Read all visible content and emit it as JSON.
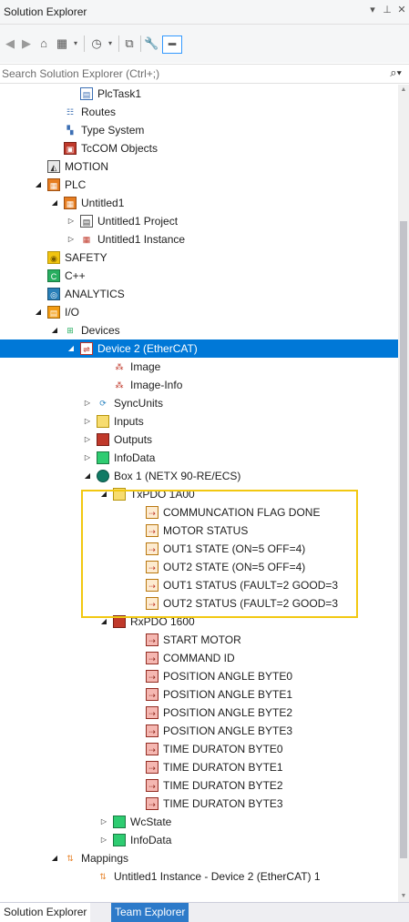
{
  "window": {
    "title": "Solution Explorer",
    "pin_glyph": "▾",
    "pin2_glyph": "⊥",
    "close_glyph": "✕"
  },
  "search": {
    "placeholder": "Search Solution Explorer (Ctrl+;)"
  },
  "tree": [
    {
      "label": "PlcTask1",
      "icon": "task-icon",
      "level": 5,
      "expander": ""
    },
    {
      "label": "Routes",
      "icon": "routes-icon",
      "level": 4,
      "expander": ""
    },
    {
      "label": "Type System",
      "icon": "type-system-icon",
      "level": 4,
      "expander": ""
    },
    {
      "label": "TcCOM Objects",
      "icon": "tccom-icon",
      "level": 4,
      "expander": ""
    },
    {
      "label": "MOTION",
      "icon": "motion-icon",
      "level": 3,
      "expander": ""
    },
    {
      "label": "PLC",
      "icon": "plc-icon",
      "level": 3,
      "expander": "open"
    },
    {
      "label": "Untitled1",
      "icon": "plc-project-icon",
      "level": 4,
      "expander": "open"
    },
    {
      "label": "Untitled1 Project",
      "icon": "project-icon",
      "level": 5,
      "expander": "closed"
    },
    {
      "label": "Untitled1 Instance",
      "icon": "instance-icon",
      "level": 5,
      "expander": "closed"
    },
    {
      "label": "SAFETY",
      "icon": "safety-icon",
      "level": 3,
      "expander": ""
    },
    {
      "label": "C++",
      "icon": "cpp-icon",
      "level": 3,
      "expander": ""
    },
    {
      "label": "ANALYTICS",
      "icon": "analytics-icon",
      "level": 3,
      "expander": ""
    },
    {
      "label": "I/O",
      "icon": "io-icon",
      "level": 3,
      "expander": "open"
    },
    {
      "label": "Devices",
      "icon": "devices-icon",
      "level": 4,
      "expander": "open"
    },
    {
      "label": "Device 2 (EtherCAT)",
      "icon": "ethercat-device-icon",
      "level": 5,
      "expander": "open",
      "selected": true
    },
    {
      "label": "Image",
      "icon": "image-icon",
      "level": 7,
      "expander": ""
    },
    {
      "label": "Image-Info",
      "icon": "image-info-icon",
      "level": 7,
      "expander": ""
    },
    {
      "label": "SyncUnits",
      "icon": "sync-icon",
      "level": 6,
      "expander": "closed"
    },
    {
      "label": "Inputs",
      "icon": "inputs-icon",
      "level": 6,
      "expander": "closed"
    },
    {
      "label": "Outputs",
      "icon": "outputs-icon",
      "level": 6,
      "expander": "closed"
    },
    {
      "label": "InfoData",
      "icon": "infodata-icon",
      "level": 6,
      "expander": "closed"
    },
    {
      "label": "Box 1 (NETX 90-RE/ECS)",
      "icon": "box-icon",
      "level": 6,
      "expander": "open"
    },
    {
      "label": "TxPDO 1A00",
      "icon": "txpdo-icon",
      "level": 7,
      "expander": "open"
    },
    {
      "label": "COMMUNCATION FLAG DONE",
      "icon": "input-var-icon",
      "level": 9,
      "expander": ""
    },
    {
      "label": "MOTOR STATUS",
      "icon": "input-var-icon",
      "level": 9,
      "expander": ""
    },
    {
      "label": "OUT1 STATE (ON=5 OFF=4)",
      "icon": "input-var-linked-icon",
      "level": 9,
      "expander": ""
    },
    {
      "label": "OUT2 STATE (ON=5 OFF=4)",
      "icon": "input-var-linked-icon",
      "level": 9,
      "expander": ""
    },
    {
      "label": "OUT1 STATUS (FAULT=2  GOOD=3",
      "icon": "input-var-linked-icon",
      "level": 9,
      "expander": ""
    },
    {
      "label": "OUT2 STATUS (FAULT=2  GOOD=3",
      "icon": "input-var-linked-icon",
      "level": 9,
      "expander": ""
    },
    {
      "label": "RxPDO 1600",
      "icon": "rxpdo-icon",
      "level": 7,
      "expander": "open"
    },
    {
      "label": "START MOTOR",
      "icon": "output-var-icon",
      "level": 9,
      "expander": ""
    },
    {
      "label": "COMMAND ID",
      "icon": "output-var-icon",
      "level": 9,
      "expander": ""
    },
    {
      "label": "POSITION ANGLE BYTE0",
      "icon": "output-var-icon",
      "level": 9,
      "expander": ""
    },
    {
      "label": "POSITION ANGLE BYTE1",
      "icon": "output-var-icon",
      "level": 9,
      "expander": ""
    },
    {
      "label": "POSITION ANGLE BYTE2",
      "icon": "output-var-icon",
      "level": 9,
      "expander": ""
    },
    {
      "label": "POSITION ANGLE BYTE3",
      "icon": "output-var-icon",
      "level": 9,
      "expander": ""
    },
    {
      "label": "TIME DURATON BYTE0",
      "icon": "output-var-icon",
      "level": 9,
      "expander": ""
    },
    {
      "label": "TIME DURATON BYTE1",
      "icon": "output-var-icon",
      "level": 9,
      "expander": ""
    },
    {
      "label": "TIME DURATON BYTE2",
      "icon": "output-var-icon",
      "level": 9,
      "expander": ""
    },
    {
      "label": "TIME DURATON BYTE3",
      "icon": "output-var-icon",
      "level": 9,
      "expander": ""
    },
    {
      "label": "WcState",
      "icon": "wcstate-icon",
      "level": 7,
      "expander": "closed"
    },
    {
      "label": "InfoData",
      "icon": "infodata-icon",
      "level": 7,
      "expander": "closed"
    },
    {
      "label": "Mappings",
      "icon": "mappings-icon",
      "level": 4,
      "expander": "open"
    },
    {
      "label": "Untitled1 Instance - Device 2 (EtherCAT) 1",
      "icon": "mapping-item-icon",
      "level": 6,
      "expander": ""
    }
  ],
  "bottom_tabs": {
    "solution_explorer": "Solution Explorer",
    "team_explorer": "Team Explorer"
  },
  "colors": {
    "selection": "#0078d7",
    "highlight_box": "#f2c811"
  }
}
